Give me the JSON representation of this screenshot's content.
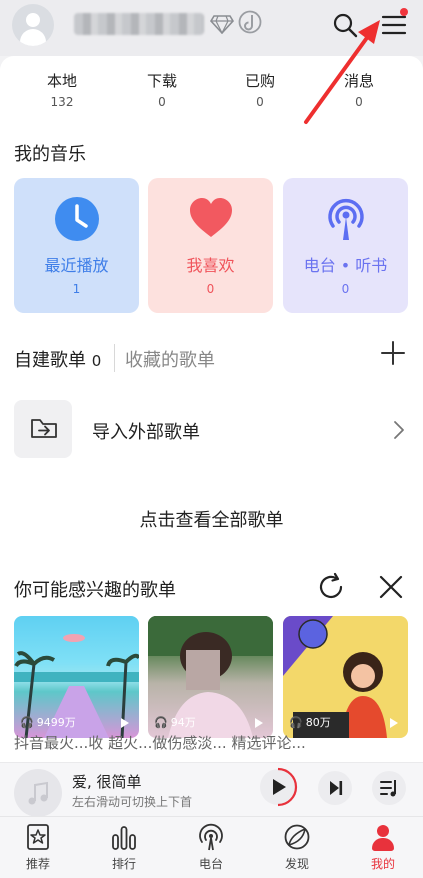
{
  "header": {
    "avatar_icon": "user-avatar-icon",
    "search_icon": "search-icon",
    "menu_icon": "hamburger-menu-icon"
  },
  "stats": [
    {
      "label": "本地",
      "count": "132"
    },
    {
      "label": "下载",
      "count": "0"
    },
    {
      "label": "已购",
      "count": "0"
    },
    {
      "label": "消息",
      "count": "0"
    }
  ],
  "my_music": {
    "title": "我的音乐",
    "cards": [
      {
        "title": "最近播放",
        "count": "1",
        "icon": "clock-icon",
        "bg": "#cfe0fa",
        "color": "#3f7ee8"
      },
      {
        "title": "我喜欢",
        "count": "0",
        "icon": "heart-icon",
        "bg": "#fde1de",
        "color": "#f0545b"
      },
      {
        "title": "电台 • 听书",
        "count": "0",
        "icon": "radio-broadcast-icon",
        "bg": "#e6e4fb",
        "color": "#6b73f0"
      }
    ]
  },
  "playlists_tabs": {
    "self": "自建歌单",
    "self_count": "0",
    "fav": "收藏的歌单"
  },
  "import": {
    "label": "导入外部歌单",
    "icon": "folder-import-icon"
  },
  "view_all": "点击查看全部歌单",
  "recommend": {
    "title": "你可能感兴趣的歌单",
    "items": [
      {
        "plays": "9499万"
      },
      {
        "plays": "94万"
      },
      {
        "plays": "80万"
      }
    ],
    "peek": "抖音最火...收    超火...做伤感淡...    精选评论..."
  },
  "player": {
    "song": "爱, 很简单",
    "hint": "左右滑动可切换上下首"
  },
  "nav": [
    {
      "label": "推荐",
      "icon": "star-doc-icon"
    },
    {
      "label": "排行",
      "icon": "bar-chart-icon"
    },
    {
      "label": "电台",
      "icon": "radio-broadcast-icon"
    },
    {
      "label": "发现",
      "icon": "compass-icon"
    },
    {
      "label": "我的",
      "icon": "user-icon"
    }
  ],
  "colors": {
    "accent": "#e8323c",
    "background": "#f2f2f4"
  }
}
